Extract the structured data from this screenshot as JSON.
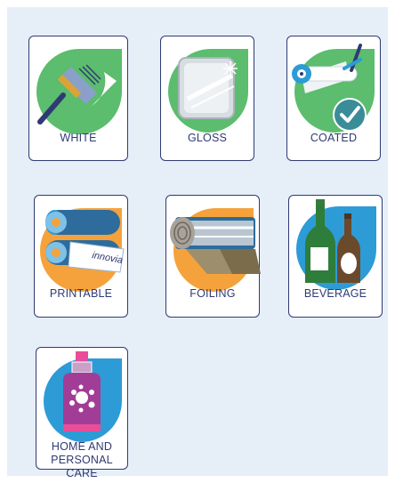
{
  "categories": [
    {
      "label": "WHITE",
      "icon": "paint-brush-icon"
    },
    {
      "label": "GLOSS",
      "icon": "gloss-sheet-icon"
    },
    {
      "label": "COATED",
      "icon": "coating-roller-checkmark-icon"
    },
    {
      "label": "PRINTABLE",
      "icon": "printing-rollers-icon"
    },
    {
      "label": "FOILING",
      "icon": "foil-roll-icon"
    },
    {
      "label": "BEVERAGE",
      "icon": "bottles-icon"
    },
    {
      "label": "HOME AND\nPERSONAL CARE",
      "icon": "soap-bottle-icon"
    }
  ],
  "roller_text": "innovia",
  "colors": {
    "green": "#5bbd6d",
    "orange": "#f5a23c",
    "blue": "#2d9bd6",
    "navy": "#2f3a73",
    "purple": "#a23d97",
    "pink": "#e84e9a",
    "teal": "#3a8c98"
  }
}
